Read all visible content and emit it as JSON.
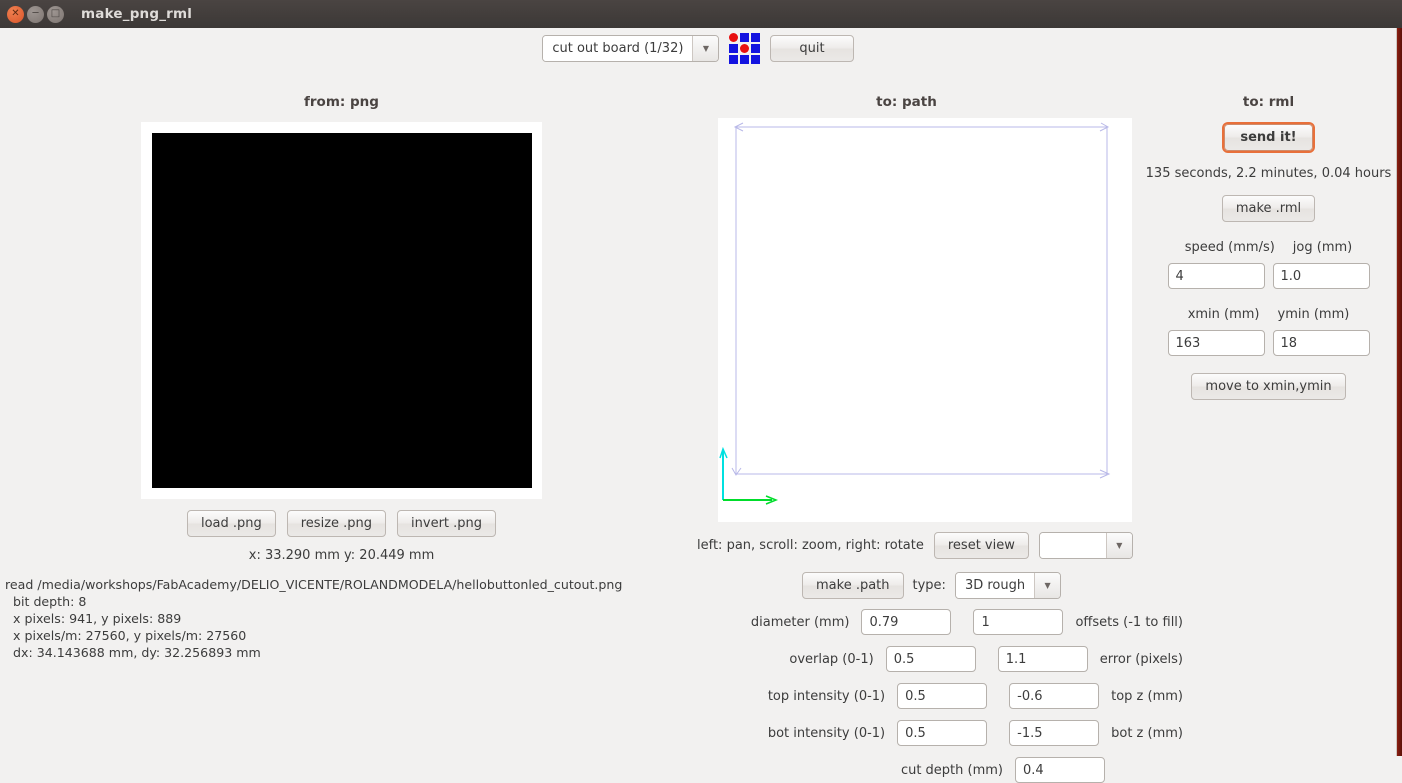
{
  "window": {
    "title": "make_png_rml",
    "controls": {
      "close": "close-window",
      "minimize": "minimize-window",
      "maximize": "maximize-window"
    }
  },
  "toolbar": {
    "machine_select": "cut out board (1/32)",
    "grid_icon": "dot-grid-icon",
    "quit_label": "quit"
  },
  "left_panel": {
    "heading": "from: png",
    "buttons": {
      "load": "load .png",
      "resize": "resize .png",
      "invert": "invert .png"
    },
    "coordinates": "x: 33.290 mm  y: 20.449 mm",
    "log": "read /media/workshops/FabAcademy/DELIO_VICENTE/ROLANDMODELA/hellobuttonled_cutout.png\n  bit depth: 8\n  x pixels: 941, y pixels: 889\n  x pixels/m: 27560, y pixels/m: 27560\n  dx: 34.143688 mm, dy: 32.256893 mm"
  },
  "center_panel": {
    "heading": "to: path",
    "mouse_hint": "left: pan, scroll: zoom, right: rotate",
    "reset_view_label": "reset view",
    "view_select": "",
    "make_path_label": "make .path",
    "type_label": "type:",
    "type_select": "3D rough",
    "fields": [
      {
        "left_label": "diameter (mm)",
        "value1": "0.79",
        "value2": "1",
        "right_label": "offsets (-1 to fill)"
      },
      {
        "left_label": "overlap (0-1)",
        "value1": "0.5",
        "value2": "1.1",
        "right_label": "error (pixels)"
      },
      {
        "left_label": "top intensity (0-1)",
        "value1": "0.5",
        "value2": "-0.6",
        "right_label": "top z (mm)"
      },
      {
        "left_label": "bot intensity (0-1)",
        "value1": "0.5",
        "value2": "-1.5",
        "right_label": "bot z (mm)"
      }
    ],
    "cut_depth_label": "cut depth (mm)",
    "cut_depth_value": "0.4"
  },
  "right_panel": {
    "heading": "to: rml",
    "send_label": "send it!",
    "time_estimate": "135 seconds, 2.2 minutes, 0.04 hours",
    "make_rml_label": "make .rml",
    "speed_label": "speed (mm/s)",
    "jog_label": "jog (mm)",
    "speed_value": "4",
    "jog_value": "1.0",
    "xmin_label": "xmin (mm)",
    "ymin_label": "ymin (mm)",
    "xmin_value": "163",
    "ymin_value": "18",
    "move_label": "move to xmin,ymin"
  },
  "colors": {
    "titlebar": "#3c3836",
    "background": "#f2f1f0",
    "focus_ring": "#e8703a",
    "path_outline": "#b8b8e8",
    "axis_x": "#00dd2b",
    "axis_y": "#00e0e0",
    "grid_blue": "#1313e0",
    "grid_red": "#e81010"
  }
}
